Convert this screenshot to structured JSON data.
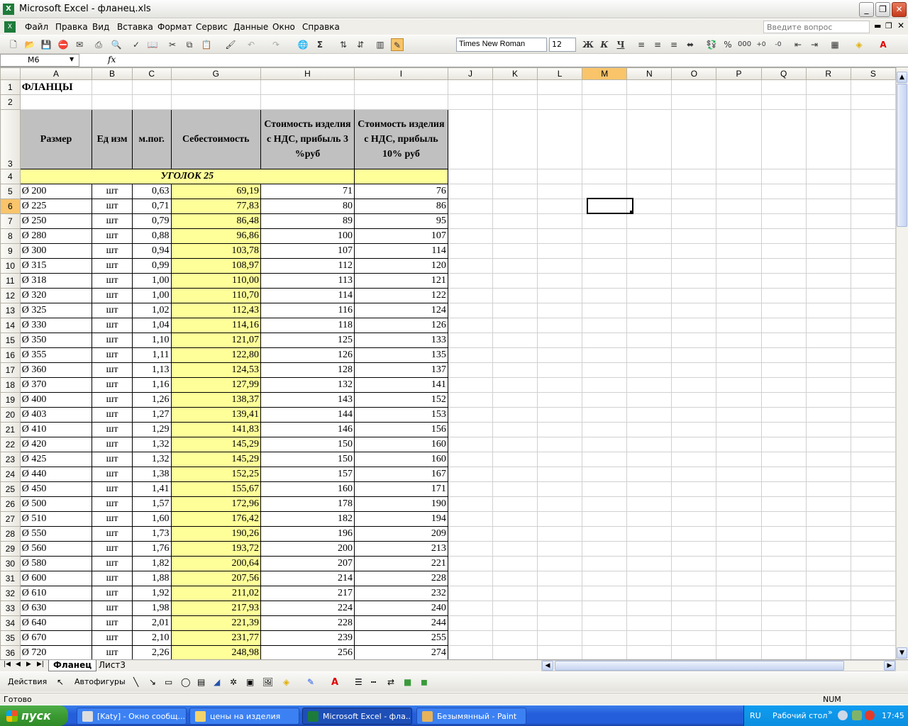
{
  "window": {
    "title": "Microsoft Excel - фланец.xls"
  },
  "menu": [
    "Файл",
    "Правка",
    "Вид",
    "Вставка",
    "Формат",
    "Сервис",
    "Данные",
    "Окно",
    "Справка"
  ],
  "ask_placeholder": "Введите вопрос",
  "format_bar": {
    "font": "Times New Roman",
    "size": "12",
    "bold": "Ж",
    "italic": "К",
    "underline": "Ч"
  },
  "formula_bar": {
    "cell": "M6",
    "fx": "fx"
  },
  "columns": [
    "A",
    "B",
    "C",
    "G",
    "H",
    "I",
    "J",
    "K",
    "L",
    "M",
    "N",
    "O",
    "P",
    "Q",
    "R",
    "S"
  ],
  "sheet": {
    "title": "ФЛАНЦЫ",
    "headers": [
      "Размер",
      "Ед изм",
      "м.пог.",
      "Себестоимость",
      "Стоимость изделия с НДС, прибыль 3 %руб",
      "Стоимость изделия с НДС, прибыль 10% руб"
    ],
    "section": "УГОЛОК 25",
    "rows": [
      {
        "n": "5",
        "size": "Ø 200",
        "unit": "шт",
        "m": "0,63",
        "cost": "69,19",
        "p3": "71",
        "p10": "76"
      },
      {
        "n": "6",
        "size": "Ø 225",
        "unit": "шт",
        "m": "0,71",
        "cost": "77,83",
        "p3": "80",
        "p10": "86"
      },
      {
        "n": "7",
        "size": "Ø 250",
        "unit": "шт",
        "m": "0,79",
        "cost": "86,48",
        "p3": "89",
        "p10": "95"
      },
      {
        "n": "8",
        "size": "Ø 280",
        "unit": "шт",
        "m": "0,88",
        "cost": "96,86",
        "p3": "100",
        "p10": "107"
      },
      {
        "n": "9",
        "size": "Ø 300",
        "unit": "шт",
        "m": "0,94",
        "cost": "103,78",
        "p3": "107",
        "p10": "114"
      },
      {
        "n": "10",
        "size": "Ø 315",
        "unit": "шт",
        "m": "0,99",
        "cost": "108,97",
        "p3": "112",
        "p10": "120"
      },
      {
        "n": "11",
        "size": "Ø 318",
        "unit": "шт",
        "m": "1,00",
        "cost": "110,00",
        "p3": "113",
        "p10": "121"
      },
      {
        "n": "12",
        "size": "Ø 320",
        "unit": "шт",
        "m": "1,00",
        "cost": "110,70",
        "p3": "114",
        "p10": "122"
      },
      {
        "n": "13",
        "size": "Ø 325",
        "unit": "шт",
        "m": "1,02",
        "cost": "112,43",
        "p3": "116",
        "p10": "124"
      },
      {
        "n": "14",
        "size": "Ø 330",
        "unit": "шт",
        "m": "1,04",
        "cost": "114,16",
        "p3": "118",
        "p10": "126"
      },
      {
        "n": "15",
        "size": "Ø 350",
        "unit": "шт",
        "m": "1,10",
        "cost": "121,07",
        "p3": "125",
        "p10": "133"
      },
      {
        "n": "16",
        "size": "Ø 355",
        "unit": "шт",
        "m": "1,11",
        "cost": "122,80",
        "p3": "126",
        "p10": "135"
      },
      {
        "n": "17",
        "size": "Ø 360",
        "unit": "шт",
        "m": "1,13",
        "cost": "124,53",
        "p3": "128",
        "p10": "137"
      },
      {
        "n": "18",
        "size": "Ø 370",
        "unit": "шт",
        "m": "1,16",
        "cost": "127,99",
        "p3": "132",
        "p10": "141"
      },
      {
        "n": "19",
        "size": "Ø 400",
        "unit": "шт",
        "m": "1,26",
        "cost": "138,37",
        "p3": "143",
        "p10": "152"
      },
      {
        "n": "20",
        "size": "Ø 403",
        "unit": "шт",
        "m": "1,27",
        "cost": "139,41",
        "p3": "144",
        "p10": "153"
      },
      {
        "n": "21",
        "size": "Ø 410",
        "unit": "шт",
        "m": "1,29",
        "cost": "141,83",
        "p3": "146",
        "p10": "156"
      },
      {
        "n": "22",
        "size": "Ø 420",
        "unit": "шт",
        "m": "1,32",
        "cost": "145,29",
        "p3": "150",
        "p10": "160"
      },
      {
        "n": "23",
        "size": "Ø 425",
        "unit": "шт",
        "m": "1,32",
        "cost": "145,29",
        "p3": "150",
        "p10": "160"
      },
      {
        "n": "24",
        "size": "Ø 440",
        "unit": "шт",
        "m": "1,38",
        "cost": "152,25",
        "p3": "157",
        "p10": "167"
      },
      {
        "n": "25",
        "size": "Ø 450",
        "unit": "шт",
        "m": "1,41",
        "cost": "155,67",
        "p3": "160",
        "p10": "171"
      },
      {
        "n": "26",
        "size": "Ø 500",
        "unit": "шт",
        "m": "1,57",
        "cost": "172,96",
        "p3": "178",
        "p10": "190"
      },
      {
        "n": "27",
        "size": "Ø 510",
        "unit": "шт",
        "m": "1,60",
        "cost": "176,42",
        "p3": "182",
        "p10": "194"
      },
      {
        "n": "28",
        "size": "Ø 550",
        "unit": "шт",
        "m": "1,73",
        "cost": "190,26",
        "p3": "196",
        "p10": "209"
      },
      {
        "n": "29",
        "size": "Ø 560",
        "unit": "шт",
        "m": "1,76",
        "cost": "193,72",
        "p3": "200",
        "p10": "213"
      },
      {
        "n": "30",
        "size": "Ø 580",
        "unit": "шт",
        "m": "1,82",
        "cost": "200,64",
        "p3": "207",
        "p10": "221"
      },
      {
        "n": "31",
        "size": "Ø 600",
        "unit": "шт",
        "m": "1,88",
        "cost": "207,56",
        "p3": "214",
        "p10": "228"
      },
      {
        "n": "32",
        "size": "Ø 610",
        "unit": "шт",
        "m": "1,92",
        "cost": "211,02",
        "p3": "217",
        "p10": "232"
      },
      {
        "n": "33",
        "size": "Ø 630",
        "unit": "шт",
        "m": "1,98",
        "cost": "217,93",
        "p3": "224",
        "p10": "240"
      },
      {
        "n": "34",
        "size": "Ø 640",
        "unit": "шт",
        "m": "2,01",
        "cost": "221,39",
        "p3": "228",
        "p10": "244"
      },
      {
        "n": "35",
        "size": "Ø 670",
        "unit": "шт",
        "m": "2,10",
        "cost": "231,77",
        "p3": "239",
        "p10": "255"
      },
      {
        "n": "36",
        "size": "Ø 720",
        "unit": "шт",
        "m": "2,26",
        "cost": "248,98",
        "p3": "256",
        "p10": "274"
      }
    ]
  },
  "tabs": [
    "Фланец",
    "Лист3"
  ],
  "draw_bar": {
    "actions": "Действия",
    "autoshapes": "Автофигуры"
  },
  "status": {
    "ready": "Готово",
    "num": "NUM"
  },
  "taskbar": {
    "start": "пуск",
    "tasks": [
      "[Katy] - Окно сообщ...",
      "цены на изделия",
      "Microsoft Excel - фла...",
      "Безымянный - Paint"
    ],
    "lang": "RU",
    "desktop": "Рабочий стол",
    "clock": "17:45"
  },
  "colors": {
    "header_gray": "#c0c0c0",
    "cost_yellow": "#ffff99",
    "selected_header": "#f9c46a",
    "taskbar_blue": "#245edb"
  }
}
